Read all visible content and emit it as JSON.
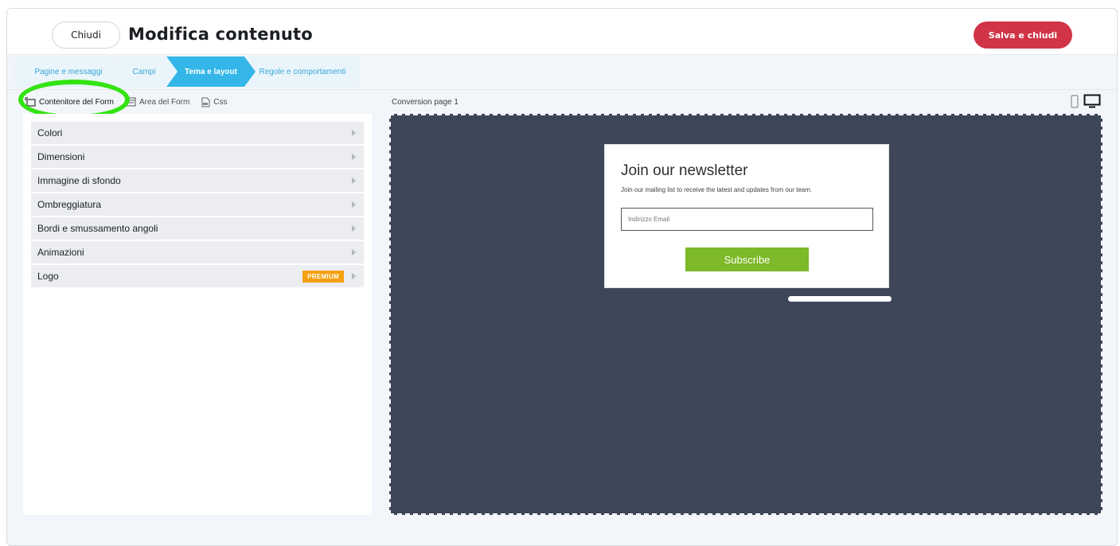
{
  "header": {
    "close_label": "Chiudi",
    "title": "Modifica contenuto",
    "save_label": "Salva e chiudi"
  },
  "steps": [
    {
      "label": "Pagine e messaggi",
      "active": false
    },
    {
      "label": "Campi",
      "active": false
    },
    {
      "label": "Tema e layout",
      "active": true
    },
    {
      "label": "Regole e comportamenti",
      "active": false
    }
  ],
  "left_tabs": [
    {
      "label": "Contenitore del Form",
      "icon": "container-icon",
      "active": true
    },
    {
      "label": "Area del Form",
      "icon": "form-area-icon",
      "active": false
    },
    {
      "label": "Css",
      "icon": "css-file-icon",
      "active": false
    }
  ],
  "accordion": [
    {
      "label": "Colori"
    },
    {
      "label": "Dimensioni"
    },
    {
      "label": "Immagine di sfondo"
    },
    {
      "label": "Ombreggiatura"
    },
    {
      "label": "Bordi e smussamento angoli"
    },
    {
      "label": "Animazioni"
    },
    {
      "label": "Logo",
      "badge": "PREMIUM"
    }
  ],
  "preview": {
    "page_label": "Conversion page 1",
    "form_title": "Join our newsletter",
    "form_subtitle": "Join our mailing list to receive the latest and updates from our team.",
    "email_placeholder": "Indirizzo Email",
    "subscribe_label": "Subscribe"
  },
  "colors": {
    "accent": "#34b6e8",
    "save": "#d13447",
    "canvas": "#3d4759",
    "subscribe": "#7db928",
    "premium": "#f4a00f",
    "highlight_ring": "#33e312"
  }
}
